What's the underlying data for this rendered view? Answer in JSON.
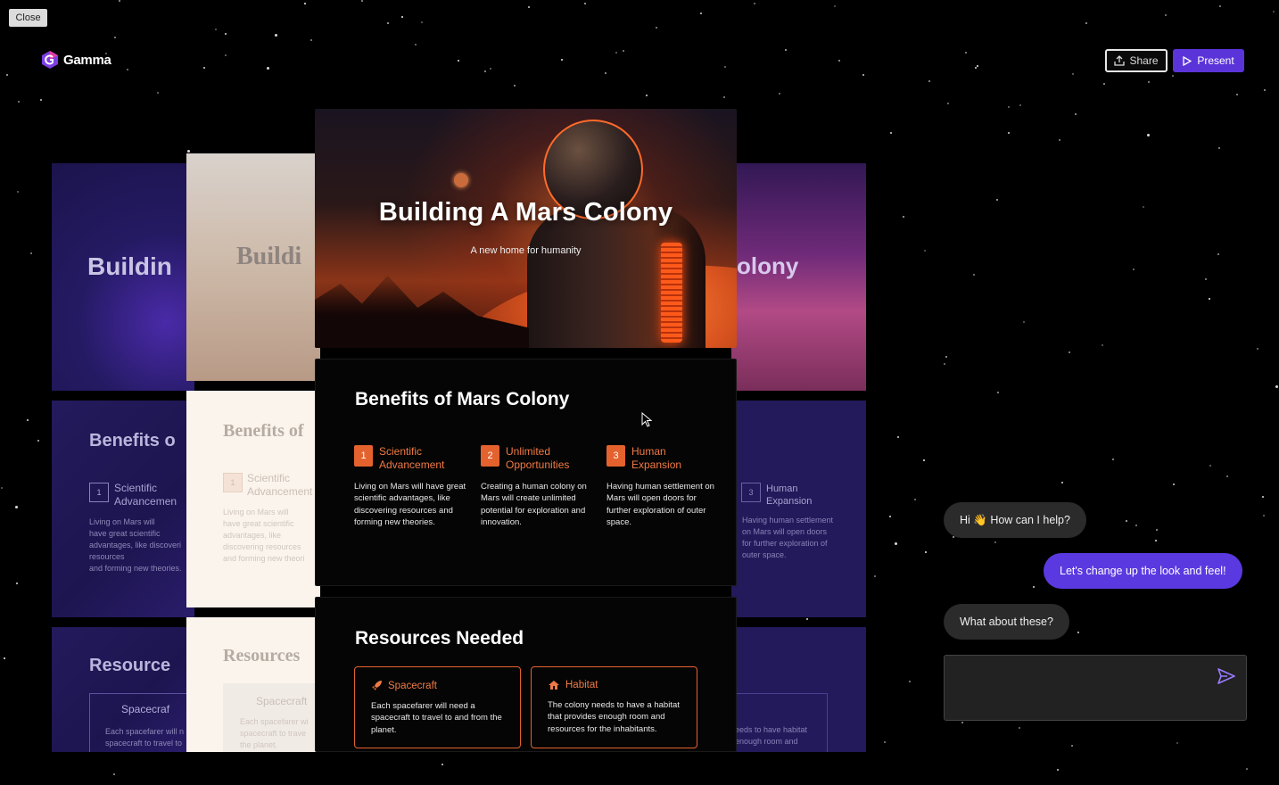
{
  "app": {
    "close_label": "Close",
    "logo_text": "Gamma",
    "share_label": "Share",
    "present_label": "Present",
    "accent_color": "#5b34d9",
    "orange_accent": "#e4622e"
  },
  "hero_slide": {
    "title": "Building A Mars Colony",
    "subtitle": "A new home for humanity"
  },
  "benefits_slide": {
    "title": "Benefits of Mars Colony",
    "items": [
      {
        "num": "1",
        "title": "Scientific\nAdvancement",
        "desc": "Living on Mars will have great scientific advantages, like discovering resources and forming new theories."
      },
      {
        "num": "2",
        "title": "Unlimited\nOpportunities",
        "desc": "Creating a human colony on Mars will create unlimited potential for exploration and innovation."
      },
      {
        "num": "3",
        "title": "Human\nExpansion",
        "desc": "Having human settlement on Mars will open doors for further exploration of outer space."
      }
    ]
  },
  "resources_slide": {
    "title": "Resources Needed",
    "items": [
      {
        "title": "Spacecraft",
        "desc": "Each spacefarer will need a spacecraft to travel to and from the planet."
      },
      {
        "title": "Habitat",
        "desc": "The colony needs to have a habitat that provides enough room and resources for the inhabitants."
      }
    ]
  },
  "ghost_decks": {
    "left": {
      "title": "Buildin",
      "benefits": "Benefits o",
      "item_num": "1",
      "item_title": "Scientific\nAdvancemen",
      "item_desc": "Living on Mars will\nhave great scientific\nadvantages, like discoveri\nresources\nand forming new theories.",
      "resources": "Resource",
      "resource_item": "Spacecraf",
      "resource_desc": "Each spacefarer will n\nspacecraft to travel to"
    },
    "cream": {
      "title": "Buildi",
      "benefits": "Benefits of",
      "item_num": "1",
      "item_title": "Scientific\nAdvancement",
      "item_desc": "Living on Mars will\nhave great scientific\nadvantages, like\ndiscovering resources\nand forming new theori",
      "resources": "Resources",
      "resource_item": "Spacecraft",
      "resource_desc": "Each spacefarer wi\nspacecraft to trave\nthe planet."
    },
    "right": {
      "title": "olony",
      "item_num": "3",
      "item_title": "Human\nExpansion",
      "item_desc": "Having human settlement\non Mars will open doors\nfor further exploration of\nouter space.",
      "resource_desc": "eeds to have habitat\nenough room and"
    }
  },
  "chat": {
    "messages": [
      {
        "role": "ai",
        "text": "Hi 👋 How can I help?"
      },
      {
        "role": "user",
        "text": "Let's change up the look and feel!"
      },
      {
        "role": "ai",
        "text": "What about these?"
      }
    ],
    "input_value": ""
  }
}
